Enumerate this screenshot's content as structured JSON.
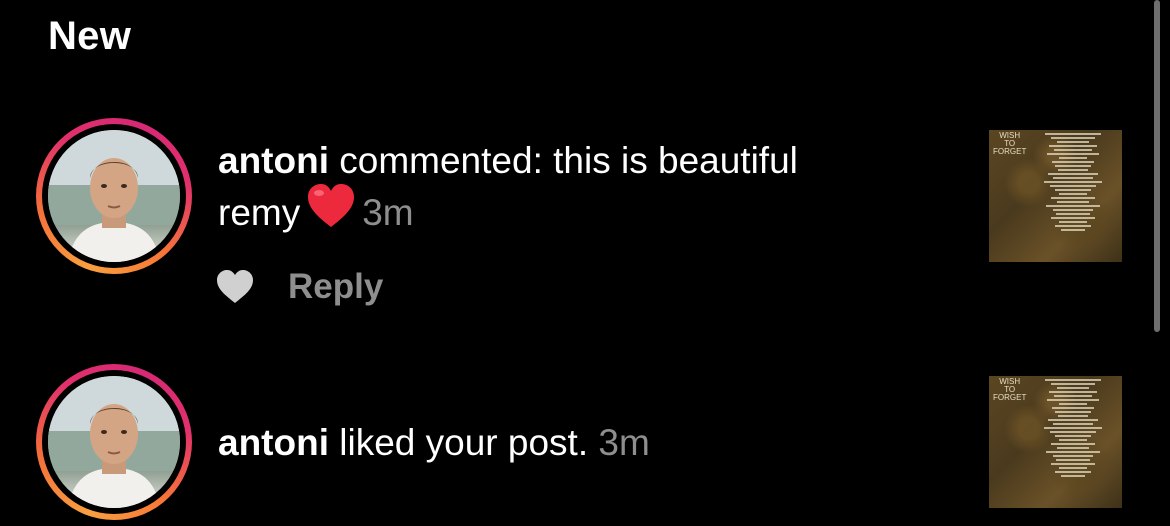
{
  "section": {
    "title": "New"
  },
  "notifications": [
    {
      "username": "antoni",
      "message": " commented: this is beautiful",
      "message_line2": "remy",
      "emoji": "heart-emoji",
      "time": "3m",
      "actions": {
        "like_icon": "heart-icon",
        "reply_label": "Reply"
      },
      "thumbnail": {
        "title_lines": [
          "WISH",
          "TO",
          "FORGET"
        ]
      }
    },
    {
      "username": "antoni",
      "message": " liked your post.",
      "time": "3m",
      "thumbnail": {
        "title_lines": [
          "WISH",
          "TO",
          "FORGET"
        ]
      }
    }
  ],
  "colors": {
    "background": "#000000",
    "text_primary": "#ffffff",
    "text_secondary": "#8e8e8e",
    "heart_red": "#ed2a3d",
    "story_ring_start": "#e1306c",
    "story_ring_end": "#f9a03f"
  }
}
